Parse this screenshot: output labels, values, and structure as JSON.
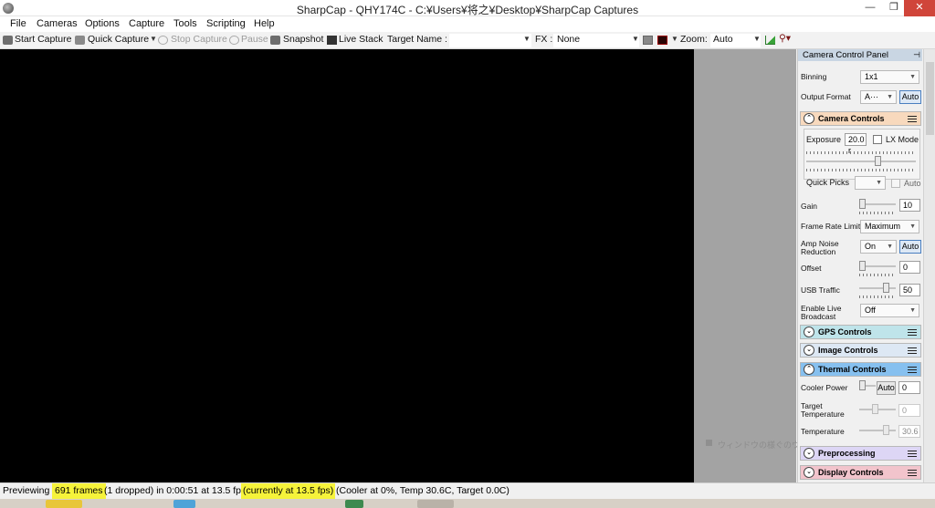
{
  "window": {
    "title": "SharpCap - QHY174C - C:¥Users¥将之¥Desktop¥SharpCap Captures",
    "min_glyph": "—",
    "max_glyph": "❐",
    "close_glyph": "✕"
  },
  "menu": {
    "items": [
      "File",
      "Cameras",
      "Options",
      "Capture",
      "Tools",
      "Scripting",
      "Help"
    ]
  },
  "toolbar": {
    "start_capture": "Start Capture",
    "quick_capture": "Quick Capture",
    "stop_capture": "Stop Capture",
    "pause": "Pause",
    "snapshot": "Snapshot",
    "live_stack": "Live Stack",
    "target_name_label": "Target Name :",
    "target_name_value": "",
    "fx_label": "FX :",
    "fx_value": "None",
    "zoom_label": "Zoom:",
    "zoom_value": "Auto"
  },
  "background_hint": "ウィンドウの様ぐのウ自動… (W)",
  "panel": {
    "title": "Camera Control Panel",
    "binning_label": "Binning",
    "binning_value": "1x1",
    "output_format_label": "Output Format",
    "output_format_value": "A···",
    "output_format_auto": "Auto",
    "camera_controls": {
      "title": "Camera Controls",
      "exposure_label": "Exposure",
      "exposure_value": "20.0 r",
      "lx_mode_label": "LX Mode",
      "exposure_slider_fraction": 0.66,
      "quick_picks_label": "Quick Picks",
      "quick_picks_auto": "Auto",
      "gain_label": "Gain",
      "gain_value": "10",
      "frame_rate_label": "Frame Rate Limit",
      "frame_rate_value": "Maximum",
      "amp_noise_label_1": "Amp Noise",
      "amp_noise_label_2": "Reduction",
      "amp_noise_value": "On",
      "amp_noise_auto": "Auto",
      "offset_label": "Offset",
      "offset_value": "0",
      "usb_traffic_label": "USB Traffic",
      "usb_traffic_value": "50",
      "live_broadcast_label_1": "Enable Live",
      "live_broadcast_label_2": "Broadcast",
      "live_broadcast_value": "Off"
    },
    "sections": {
      "gps": "GPS Controls",
      "image": "Image Controls",
      "thermal": "Thermal Controls",
      "preprocessing": "Preprocessing",
      "display": "Display Controls"
    },
    "thermal": {
      "cooler_power_label": "Cooler Power",
      "cooler_power_auto": "Auto",
      "cooler_power_value": "0",
      "target_temp_label_1": "Target",
      "target_temp_label_2": "Temperature",
      "target_temp_value": "0",
      "temperature_label": "Temperature",
      "temperature_value": "30.6"
    },
    "colors": {
      "camera_controls": "#f8d9bd",
      "gps": "#bfe4ea",
      "image": "#dde8f4",
      "thermal": "#86c0ef",
      "preprocessing": "#ddd6f5",
      "display": "#f2c4cc"
    }
  },
  "status": {
    "part1": "Previewing :",
    "frames": "691 frames",
    "part2": "(1 dropped) in 0:00:51 at 13.5 fps",
    "current": "(currently at 13.5 fps)",
    "part3": "(Cooler at 0%, Temp 30.6C, Target 0.0C)"
  }
}
